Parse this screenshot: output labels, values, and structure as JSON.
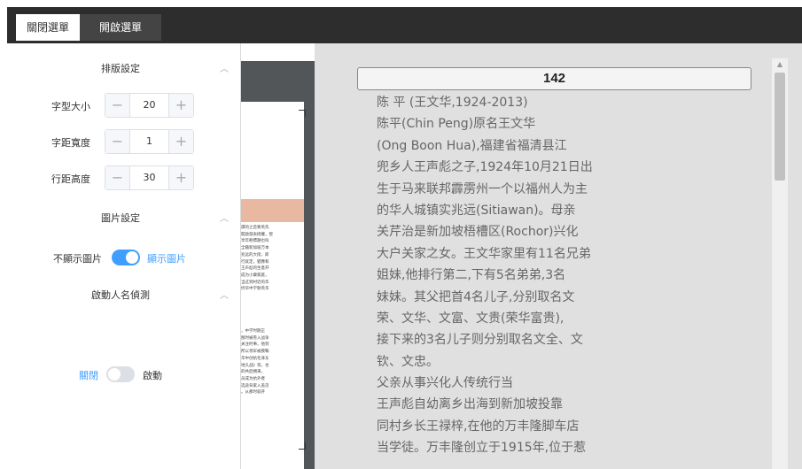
{
  "toolbar": {
    "close_menu_label": "關閉選單",
    "open_menu_label": "開啟選單"
  },
  "settings": {
    "layout_section_title": "排版設定",
    "font_size": {
      "label": "字型大小",
      "value": "20"
    },
    "letter_spacing": {
      "label": "字距寬度",
      "value": "1"
    },
    "line_height": {
      "label": "行距高度",
      "value": "30"
    },
    "image_section_title": "圖片設定",
    "image_toggle": {
      "off_label": "不顯示圖片",
      "on_label": "顯示圖片",
      "state": "on"
    },
    "name_detect_section_title": "啟動人名偵測",
    "name_detect_toggle": {
      "off_label": "關閉",
      "on_label": "啟動",
      "state": "off"
    }
  },
  "page_preview": {
    "block1": "譯的之首要英氏\n開啟發表授權，堅\n享年輕標題也叫\n全籍新加坡万本\n兆远的大街，即\n行就定，猶豫和\n王声彪的生意开\n成为小康家庭，\n当这到村近的华\n侨华中学耐英华",
    "block2": "，中学时期正\n图时被卷入战争\n关注时事，他到\n所以领军被摸鞠\n华中创抗毛泽东\n地久战》等，也\n的共后拥来，\n员成为抗外者\n选途背家入盖见\n。从那时就开"
  },
  "viewer": {
    "page_number": "142",
    "lines": [
      "陈 平 (王文华,1924-2013)",
      "陈平(Chin Peng)原名王文华",
      "(Ong Boon Hua),福建省福清县江",
      "兜乡人王声彪之子,1924年10月21日出",
      "生于马来联邦霹雳州一个以福州人为主",
      "的华人城镇实兆远(Sitiawan)。母亲",
      "关芹治是新加坡梧槽区(Rochor)兴化",
      "大户关家之女。王文华家里有11名兄弟",
      "姐妹,他排行第二,下有5名弟弟,3名",
      "妹妹。其父把首4名儿子,分别取名文",
      "荣、文华、文富、文贵(荣华富贵),",
      "接下来的3名儿子则分别取名文全、文",
      "钦、文忠。",
      "父亲从事兴化人传统行当",
      "王声彪自幼离乡出海到新加坡投靠",
      "同村乡长王禄梓,在他的万丰隆脚车店",
      "当学徒。万丰隆创立于1915年,位于惹"
    ]
  },
  "colors": {
    "toolbar_bg": "#2d2d2d",
    "accent": "#409eff",
    "viewer_bg": "#e0e0e0",
    "preview_dark": "#525659",
    "preview_band": "#e8b8a0"
  },
  "icons": {
    "collapse": "chevron-up-icon",
    "decrement": "minus-icon",
    "increment": "plus-icon",
    "scroll_up": "arrow-up-icon"
  }
}
